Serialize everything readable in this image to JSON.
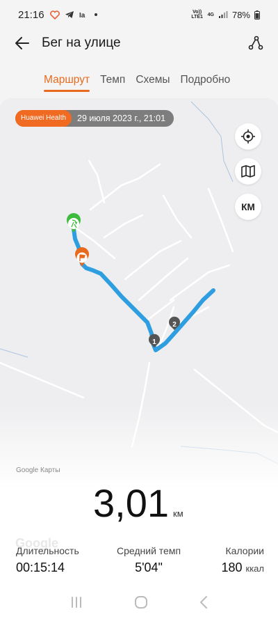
{
  "status_bar": {
    "time": "21:16",
    "net_volte": "Vo)) LTE1",
    "net_type": "4G",
    "battery": "78%"
  },
  "header": {
    "title": "Бег на улице"
  },
  "tabs": [
    {
      "label": "Маршрут",
      "active": true
    },
    {
      "label": "Темп",
      "active": false
    },
    {
      "label": "Схемы",
      "active": false
    },
    {
      "label": "Подробно",
      "active": false
    }
  ],
  "map": {
    "source_chip": "Huawei Health",
    "date": "29 июля 2023 г., 21:01",
    "km_button": "КМ",
    "google_label": "Google Карты",
    "google_watermark": "Google",
    "markers": [
      "1",
      "2"
    ],
    "route_color": "#2f9ee0",
    "start_color": "#3dbb3d",
    "finish_color": "#e86a1d"
  },
  "stats": {
    "distance_value": "3,01",
    "distance_unit": "км",
    "duration_label": "Длительность",
    "duration_value": "00:15:14",
    "pace_label": "Средний темп",
    "pace_value": "5'04\"",
    "calories_label": "Калории",
    "calories_value": "180",
    "calories_unit": "ккал"
  },
  "colors": {
    "accent": "#e86a1d",
    "chip_bg": "#7d7d7d"
  }
}
